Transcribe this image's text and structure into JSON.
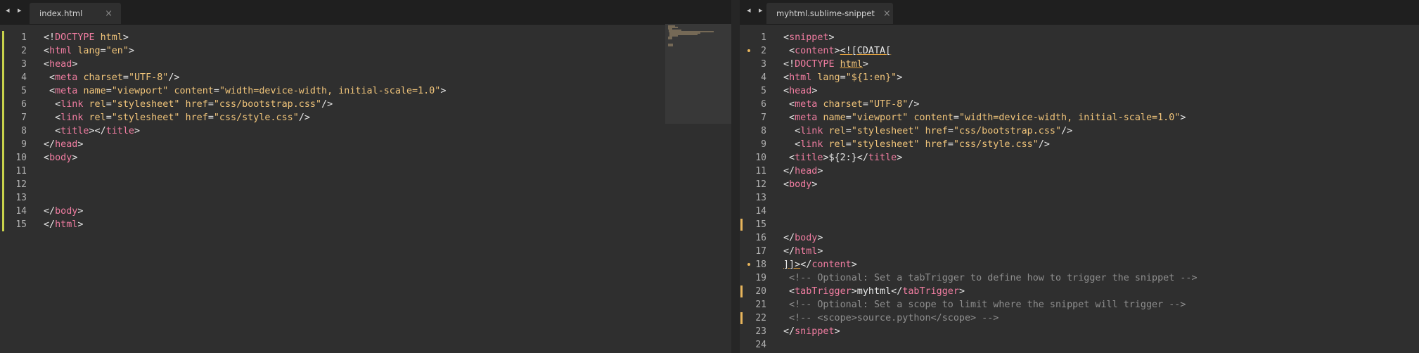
{
  "left_pane": {
    "tab": {
      "title": "index.html",
      "close_glyph": "×"
    },
    "nav_arrows": "◂ ▸",
    "lines": [
      {
        "n": "1",
        "mod": true,
        "segs": [
          [
            "p",
            "<!"
          ],
          [
            "t",
            "DOCTYPE"
          ],
          [
            "p",
            " "
          ],
          [
            "a",
            "html"
          ],
          [
            "p",
            ">"
          ]
        ]
      },
      {
        "n": "2",
        "mod": true,
        "segs": [
          [
            "p",
            "<"
          ],
          [
            "t",
            "html"
          ],
          [
            "p",
            " "
          ],
          [
            "a",
            "lang"
          ],
          [
            "p",
            "="
          ],
          [
            "s",
            "\"en\""
          ],
          [
            "p",
            ">"
          ]
        ]
      },
      {
        "n": "3",
        "mod": true,
        "segs": [
          [
            "p",
            "<"
          ],
          [
            "t",
            "head"
          ],
          [
            "p",
            ">"
          ]
        ]
      },
      {
        "n": "4",
        "mod": true,
        "segs": [
          [
            "p",
            " <"
          ],
          [
            "t",
            "meta"
          ],
          [
            "p",
            " "
          ],
          [
            "a",
            "charset"
          ],
          [
            "p",
            "="
          ],
          [
            "s",
            "\"UTF-8\""
          ],
          [
            "p",
            "/>"
          ]
        ]
      },
      {
        "n": "5",
        "mod": true,
        "segs": [
          [
            "p",
            " <"
          ],
          [
            "t",
            "meta"
          ],
          [
            "p",
            " "
          ],
          [
            "a",
            "name"
          ],
          [
            "p",
            "="
          ],
          [
            "s",
            "\"viewport\""
          ],
          [
            "p",
            " "
          ],
          [
            "a",
            "content"
          ],
          [
            "p",
            "="
          ],
          [
            "s",
            "\"width=device-width, initial-scale=1.0\""
          ],
          [
            "p",
            ">"
          ]
        ]
      },
      {
        "n": "6",
        "mod": true,
        "segs": [
          [
            "p",
            "  <"
          ],
          [
            "t",
            "link"
          ],
          [
            "p",
            " "
          ],
          [
            "a",
            "rel"
          ],
          [
            "p",
            "="
          ],
          [
            "s",
            "\"stylesheet\""
          ],
          [
            "p",
            " "
          ],
          [
            "a",
            "href"
          ],
          [
            "p",
            "="
          ],
          [
            "s",
            "\"css/bootstrap.css\""
          ],
          [
            "p",
            "/>"
          ]
        ]
      },
      {
        "n": "7",
        "mod": true,
        "segs": [
          [
            "p",
            "  <"
          ],
          [
            "t",
            "link"
          ],
          [
            "p",
            " "
          ],
          [
            "a",
            "rel"
          ],
          [
            "p",
            "="
          ],
          [
            "s",
            "\"stylesheet\""
          ],
          [
            "p",
            " "
          ],
          [
            "a",
            "href"
          ],
          [
            "p",
            "="
          ],
          [
            "s",
            "\"css/style.css\""
          ],
          [
            "p",
            "/>"
          ]
        ]
      },
      {
        "n": "8",
        "mod": true,
        "segs": [
          [
            "p",
            "  <"
          ],
          [
            "t",
            "title"
          ],
          [
            "p",
            "></"
          ],
          [
            "t",
            "title"
          ],
          [
            "p",
            ">"
          ]
        ]
      },
      {
        "n": "9",
        "mod": true,
        "segs": [
          [
            "p",
            "</"
          ],
          [
            "t",
            "head"
          ],
          [
            "p",
            ">"
          ]
        ]
      },
      {
        "n": "10",
        "mod": true,
        "segs": [
          [
            "p",
            "<"
          ],
          [
            "t",
            "body"
          ],
          [
            "p",
            ">"
          ]
        ]
      },
      {
        "n": "11",
        "mod": true,
        "segs": []
      },
      {
        "n": "12",
        "mod": true,
        "segs": []
      },
      {
        "n": "13",
        "mod": true,
        "segs": []
      },
      {
        "n": "14",
        "mod": true,
        "segs": [
          [
            "p",
            "</"
          ],
          [
            "t",
            "body"
          ],
          [
            "p",
            ">"
          ]
        ]
      },
      {
        "n": "15",
        "mod": true,
        "segs": [
          [
            "p",
            "</"
          ],
          [
            "t",
            "html"
          ],
          [
            "p",
            ">"
          ]
        ]
      }
    ]
  },
  "right_pane": {
    "tab": {
      "title": "myhtml.sublime-snippet",
      "close_glyph": "×"
    },
    "nav_arrows": "◂ ▸",
    "menu_glyph": "▼",
    "lines": [
      {
        "n": "1",
        "segs": [
          [
            "p",
            "<"
          ],
          [
            "t",
            "snippet"
          ],
          [
            "p",
            ">"
          ]
        ]
      },
      {
        "n": "2",
        "dot": true,
        "segs": [
          [
            "p",
            " <"
          ],
          [
            "t",
            "content"
          ],
          [
            "p",
            ">"
          ],
          [
            "pu",
            "<![CDATA["
          ]
        ]
      },
      {
        "n": "3",
        "segs": [
          [
            "p",
            "<!"
          ],
          [
            "t",
            "DOCTYPE"
          ],
          [
            "p",
            " "
          ],
          [
            "au",
            "html"
          ],
          [
            "p",
            ">"
          ]
        ]
      },
      {
        "n": "4",
        "segs": [
          [
            "p",
            "<"
          ],
          [
            "t",
            "html"
          ],
          [
            "p",
            " "
          ],
          [
            "a",
            "lang"
          ],
          [
            "p",
            "="
          ],
          [
            "s",
            "\"${1:en}\""
          ],
          [
            "p",
            ">"
          ]
        ]
      },
      {
        "n": "5",
        "segs": [
          [
            "p",
            "<"
          ],
          [
            "t",
            "head"
          ],
          [
            "p",
            ">"
          ]
        ]
      },
      {
        "n": "6",
        "segs": [
          [
            "p",
            " <"
          ],
          [
            "t",
            "meta"
          ],
          [
            "p",
            " "
          ],
          [
            "a",
            "charset"
          ],
          [
            "p",
            "="
          ],
          [
            "s",
            "\"UTF-8\""
          ],
          [
            "p",
            "/>"
          ]
        ]
      },
      {
        "n": "7",
        "segs": [
          [
            "p",
            " <"
          ],
          [
            "t",
            "meta"
          ],
          [
            "p",
            " "
          ],
          [
            "a",
            "name"
          ],
          [
            "p",
            "="
          ],
          [
            "s",
            "\"viewport\""
          ],
          [
            "p",
            " "
          ],
          [
            "a",
            "content"
          ],
          [
            "p",
            "="
          ],
          [
            "s",
            "\"width=device-width, initial-scale=1.0\""
          ],
          [
            "p",
            ">"
          ]
        ]
      },
      {
        "n": "8",
        "segs": [
          [
            "p",
            "  <"
          ],
          [
            "t",
            "link"
          ],
          [
            "p",
            " "
          ],
          [
            "a",
            "rel"
          ],
          [
            "p",
            "="
          ],
          [
            "s",
            "\"stylesheet\""
          ],
          [
            "p",
            " "
          ],
          [
            "a",
            "href"
          ],
          [
            "p",
            "="
          ],
          [
            "s",
            "\"css/bootstrap.css\""
          ],
          [
            "p",
            "/>"
          ]
        ]
      },
      {
        "n": "9",
        "segs": [
          [
            "p",
            "  <"
          ],
          [
            "t",
            "link"
          ],
          [
            "p",
            " "
          ],
          [
            "a",
            "rel"
          ],
          [
            "p",
            "="
          ],
          [
            "s",
            "\"stylesheet\""
          ],
          [
            "p",
            " "
          ],
          [
            "a",
            "href"
          ],
          [
            "p",
            "="
          ],
          [
            "s",
            "\"css/style.css\""
          ],
          [
            "p",
            "/>"
          ]
        ]
      },
      {
        "n": "10",
        "segs": [
          [
            "p",
            " <"
          ],
          [
            "t",
            "title"
          ],
          [
            "p",
            ">${2:}</"
          ],
          [
            "t",
            "title"
          ],
          [
            "p",
            ">"
          ]
        ]
      },
      {
        "n": "11",
        "segs": [
          [
            "p",
            "</"
          ],
          [
            "t",
            "head"
          ],
          [
            "p",
            ">"
          ]
        ]
      },
      {
        "n": "12",
        "segs": [
          [
            "p",
            "<"
          ],
          [
            "t",
            "body"
          ],
          [
            "p",
            ">"
          ]
        ]
      },
      {
        "n": "13",
        "segs": []
      },
      {
        "n": "14",
        "segs": []
      },
      {
        "n": "15",
        "bar": true,
        "segs": []
      },
      {
        "n": "16",
        "segs": [
          [
            "p",
            "</"
          ],
          [
            "t",
            "body"
          ],
          [
            "p",
            ">"
          ]
        ]
      },
      {
        "n": "17",
        "segs": [
          [
            "p",
            "</"
          ],
          [
            "t",
            "html"
          ],
          [
            "p",
            ">"
          ]
        ]
      },
      {
        "n": "18",
        "dot": true,
        "segs": [
          [
            "pu",
            "]]>"
          ],
          [
            "p",
            "</"
          ],
          [
            "t",
            "content"
          ],
          [
            "p",
            ">"
          ]
        ]
      },
      {
        "n": "19",
        "segs": [
          [
            "c",
            " <!-- Optional: Set a tabTrigger to define how to trigger the snippet -->"
          ]
        ]
      },
      {
        "n": "20",
        "bar": true,
        "segs": [
          [
            "p",
            " <"
          ],
          [
            "t",
            "tabTrigger"
          ],
          [
            "p",
            ">myhtml</"
          ],
          [
            "t",
            "tabTrigger"
          ],
          [
            "p",
            ">"
          ]
        ]
      },
      {
        "n": "21",
        "segs": [
          [
            "c",
            " <!-- Optional: Set a scope to limit where the snippet will trigger -->"
          ]
        ]
      },
      {
        "n": "22",
        "bar": true,
        "segs": [
          [
            "c",
            " <!-- <scope>source.python</scope> -->"
          ]
        ]
      },
      {
        "n": "23",
        "segs": [
          [
            "p",
            "</"
          ],
          [
            "t",
            "snippet"
          ],
          [
            "p",
            ">"
          ]
        ]
      },
      {
        "n": "24",
        "segs": []
      }
    ]
  }
}
